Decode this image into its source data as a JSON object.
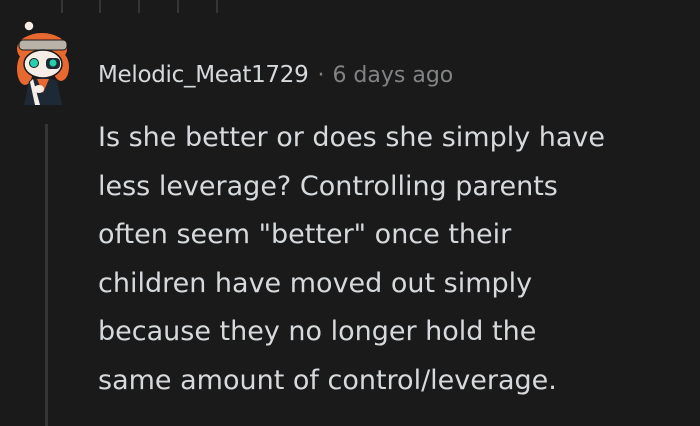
{
  "comment": {
    "author": "Melodic_Meat1729",
    "separator": "·",
    "timestamp": "6 days ago",
    "body": "Is she better or does she simply have\nless leverage? Controlling parents\noften seem \"better\" once their\nchildren have moved out simply\nbecause they no longer hold the\nsame amount of control/leverage."
  },
  "avatar": {
    "icon": "snoo-avatar-icon",
    "colors": {
      "hair": "#e8692f",
      "headband": "#b9b2a9",
      "skin": "#f5ede6",
      "eyes": "#27d0ac",
      "outfit": "#1d2a36"
    }
  },
  "colors": {
    "background": "#1a1a1b",
    "text": "#d7dadc",
    "meta": "#818384",
    "thread_line": "#343536"
  }
}
